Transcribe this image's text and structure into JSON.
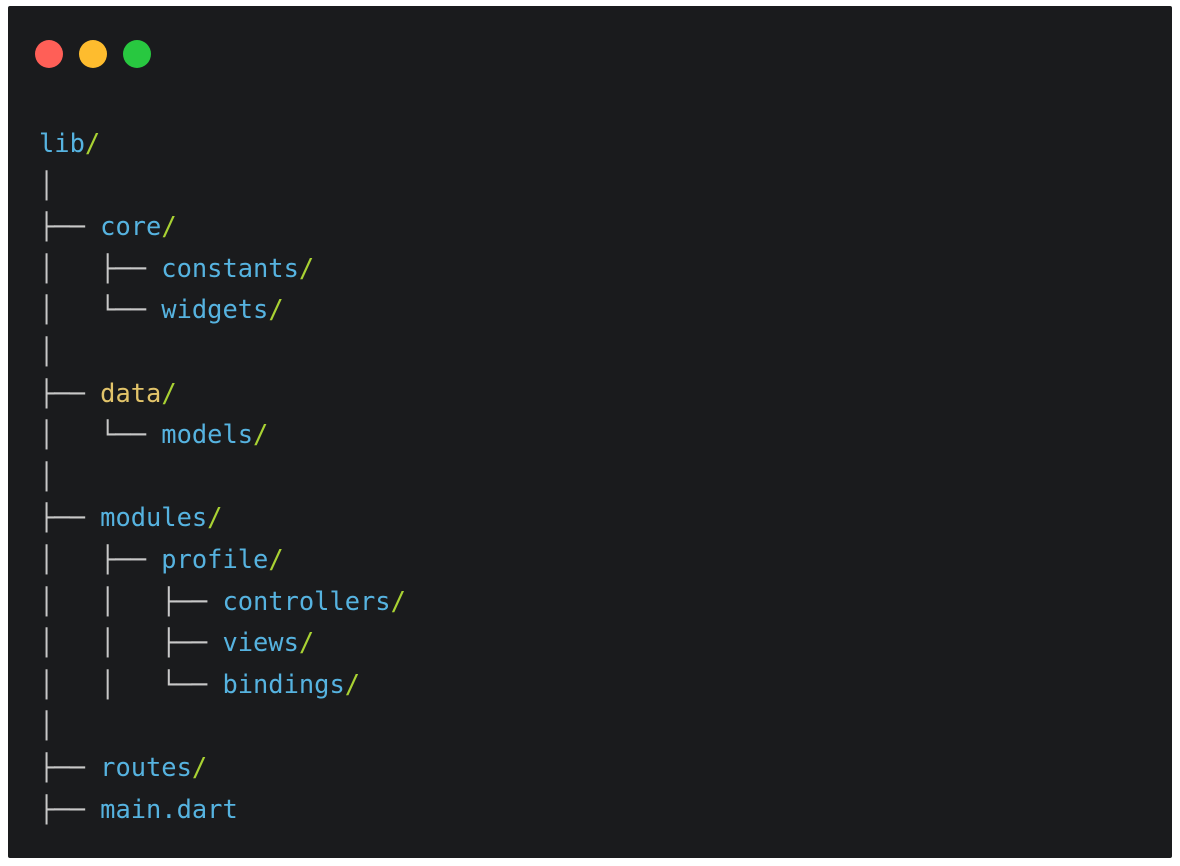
{
  "window_controls": {
    "close_color": "#ff5f57",
    "minimize_color": "#febc2e",
    "maximize_color": "#28c840"
  },
  "colors": {
    "background": "#1a1b1d",
    "folder": "#56b3e0",
    "folder_highlight": "#e2c46a",
    "slash": "#a9d233",
    "guide": "#c8c8c8"
  },
  "tree": [
    {
      "prefix": "",
      "name": "lib",
      "suffix": "/",
      "highlight": false
    },
    {
      "prefix": "│",
      "name": "",
      "suffix": "",
      "highlight": false
    },
    {
      "prefix": "├── ",
      "name": "core",
      "suffix": "/",
      "highlight": false
    },
    {
      "prefix": "│   ├── ",
      "name": "constants",
      "suffix": "/",
      "highlight": false
    },
    {
      "prefix": "│   └── ",
      "name": "widgets",
      "suffix": "/",
      "highlight": false
    },
    {
      "prefix": "│",
      "name": "",
      "suffix": "",
      "highlight": false
    },
    {
      "prefix": "├── ",
      "name": "data",
      "suffix": "/",
      "highlight": true
    },
    {
      "prefix": "│   └── ",
      "name": "models",
      "suffix": "/",
      "highlight": false
    },
    {
      "prefix": "│",
      "name": "",
      "suffix": "",
      "highlight": false
    },
    {
      "prefix": "├── ",
      "name": "modules",
      "suffix": "/",
      "highlight": false
    },
    {
      "prefix": "│   ├── ",
      "name": "profile",
      "suffix": "/",
      "highlight": false
    },
    {
      "prefix": "│   │   ├── ",
      "name": "controllers",
      "suffix": "/",
      "highlight": false
    },
    {
      "prefix": "│   │   ├── ",
      "name": "views",
      "suffix": "/",
      "highlight": false
    },
    {
      "prefix": "│   │   └── ",
      "name": "bindings",
      "suffix": "/",
      "highlight": false
    },
    {
      "prefix": "│",
      "name": "",
      "suffix": "",
      "highlight": false
    },
    {
      "prefix": "├── ",
      "name": "routes",
      "suffix": "/",
      "highlight": false
    },
    {
      "prefix": "├── ",
      "name": "main.dart",
      "suffix": "",
      "highlight": false
    }
  ]
}
